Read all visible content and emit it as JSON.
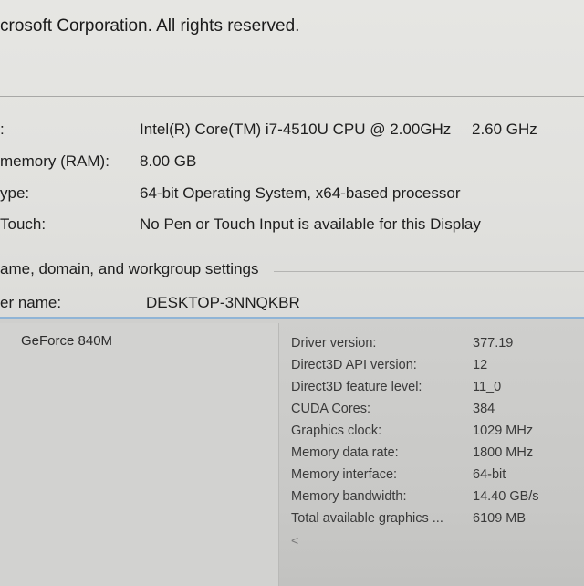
{
  "system": {
    "copyright": "crosoft Corporation. All rights reserved.",
    "rows": [
      {
        "label": ":",
        "value": "Intel(R) Core(TM) i7-4510U CPU @ 2.00GHz",
        "value2": "2.60 GHz"
      },
      {
        "label": "memory (RAM):",
        "value": "8.00 GB"
      },
      {
        "label": "ype:",
        "value": "64-bit Operating System, x64-based processor"
      },
      {
        "label": "Touch:",
        "value": "No Pen or Touch Input is available for this Display"
      }
    ],
    "section_title": "ame, domain, and workgroup settings",
    "computer_name": {
      "label": "er name:",
      "value": "DESKTOP-3NNQKBR"
    }
  },
  "nvidia": {
    "gpu_name": "GeForce 840M",
    "details": [
      {
        "key": "Driver version:",
        "value": "377.19"
      },
      {
        "key": "Direct3D API version:",
        "value": "12"
      },
      {
        "key": "Direct3D feature level:",
        "value": "11_0"
      },
      {
        "key": "CUDA Cores:",
        "value": "384"
      },
      {
        "key": "Graphics clock:",
        "value": "1029 MHz"
      },
      {
        "key": "Memory data rate:",
        "value": "1800 MHz"
      },
      {
        "key": "Memory interface:",
        "value": "64-bit"
      },
      {
        "key": "Memory bandwidth:",
        "value": "14.40 GB/s"
      },
      {
        "key": "Total available graphics ...",
        "value": "6109 MB"
      }
    ],
    "scroll_arrow": "<"
  }
}
